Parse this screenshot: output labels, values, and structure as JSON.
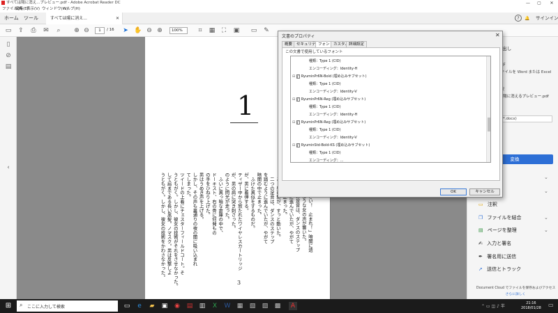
{
  "window": {
    "title": "すべては陽に消え...プレビュー.pdf - Adobe Acrobat Reader DC",
    "controls": [
      "—",
      "▢",
      "✕"
    ]
  },
  "menu": [
    "ファイル(F)",
    "編集(E)",
    "表示(V)",
    "ウィンドウ(W)",
    "ヘルプ(H)"
  ],
  "tabs": {
    "home": "ホーム",
    "tools": "ツール",
    "document": "すべては陽に消え...",
    "help": "?",
    "signin": "サインイン"
  },
  "toolbar": {
    "page_current": "1",
    "page_total": "/ 16",
    "zoom": "100%"
  },
  "document": {
    "chapter_number": "1",
    "page_number": "3",
    "columns": [
      "まりなさい！　止まれ！」暗闇に透",
      "き通るような女の声が響いた。",
      "　二つの足音は、ダンスのステップ",
      "を踏むように進んでいたが、やがて",
      "暗闇の中で止まった。",
      "　と、男の影が、すっと動いた。",
      "　二つの足音は、ダンスのステップ",
      "を踏むように進んでいたが、やがて",
      "暗闇の中で止まった。",
      "　ふけた真似をするものだ。",
      "が、男に着弾する。",
      "ティザー中から放たれたワイヤレスカートリッジ",
      "が、男の肩に突き刺さった。",
      "のように閃光が走った。",
      "　ふいに真っ暗な倉庫の中で、",
      "ドーキスト、右の骨に何発もの",
      "の手をひねり上げた。",
      "男はうめき声を上げる。",
      "しかし、その声も裏通りの夜の闇に吸い込まれ",
      "てしまった。",
      "ツイードの上着にチェスターフィールドコート。そ",
      "うともがく。しかし、彼女の技術がそれをさせなかった。",
      "して肩まである長い黒髪。ノマスク。男は反撃しよ",
      "うともがく。しかし、彼女の技術をかわさなかった。"
    ]
  },
  "right_panel": {
    "export_title": "PDF を書き出し",
    "pdf_label": "PDF",
    "desc": "PDF ファイルを Word または Excel に",
    "select_label": "選択",
    "file_name": "すべては陽に消えるプレビュー.pdf",
    "format": "Word (*.docx)",
    "convert_button": "変換",
    "sections": [
      "作成",
      "編集",
      "注釈",
      "ファイルを結合",
      "ページを整理",
      "入力と署名",
      "署名用に送信",
      "送信とトラック"
    ],
    "footer": "Document Cloud でファイルを保存およびアクセス",
    "footer_link": "さらに詳しく"
  },
  "dialog": {
    "title": "文書のプロパティ",
    "tabs": [
      "概要",
      "セキュリティ",
      "フォント",
      "カスタム",
      "詳細設定"
    ],
    "active_tab": "フォント",
    "caption": "この文書で使用しているフォント",
    "font_rows": [
      {
        "kind": "prop",
        "text": "種類：Type 1 (CID)"
      },
      {
        "kind": "prop",
        "text": "エンコーディング：Identity-H"
      },
      {
        "kind": "font",
        "text": "RyuminPr6N-Bold (埋め込みサブセット)"
      },
      {
        "kind": "prop",
        "text": "種類：Type 1 (CID)"
      },
      {
        "kind": "prop",
        "text": "エンコーディング：Identity-V"
      },
      {
        "kind": "font",
        "text": "RyuminPr6N-Reg (埋め込みサブセット)"
      },
      {
        "kind": "prop",
        "text": "種類：Type 1 (CID)"
      },
      {
        "kind": "prop",
        "text": "エンコーディング：Identity-H"
      },
      {
        "kind": "font",
        "text": "RyuminPr6N-Reg (埋め込みサブセット)"
      },
      {
        "kind": "prop",
        "text": "種類：Type 1 (CID)"
      },
      {
        "kind": "prop",
        "text": "エンコーディング：Identity-V"
      },
      {
        "kind": "font",
        "text": "RyuminStd-Bold-KS (埋め込みサブセット)"
      },
      {
        "kind": "prop",
        "text": "種類：Type 1 (CID)"
      },
      {
        "kind": "prop",
        "text": "エンコーディング：..."
      }
    ],
    "ok_button": "OK",
    "cancel_button": "キャンセル"
  },
  "taskbar": {
    "search_placeholder": "ここに入力して検索",
    "time": "21:16",
    "date": "2018/01/28"
  },
  "colors": {
    "accent": "#2d6fd6",
    "doc_bg": "#8a8a8a",
    "taskbar": "#1b1b1b"
  }
}
